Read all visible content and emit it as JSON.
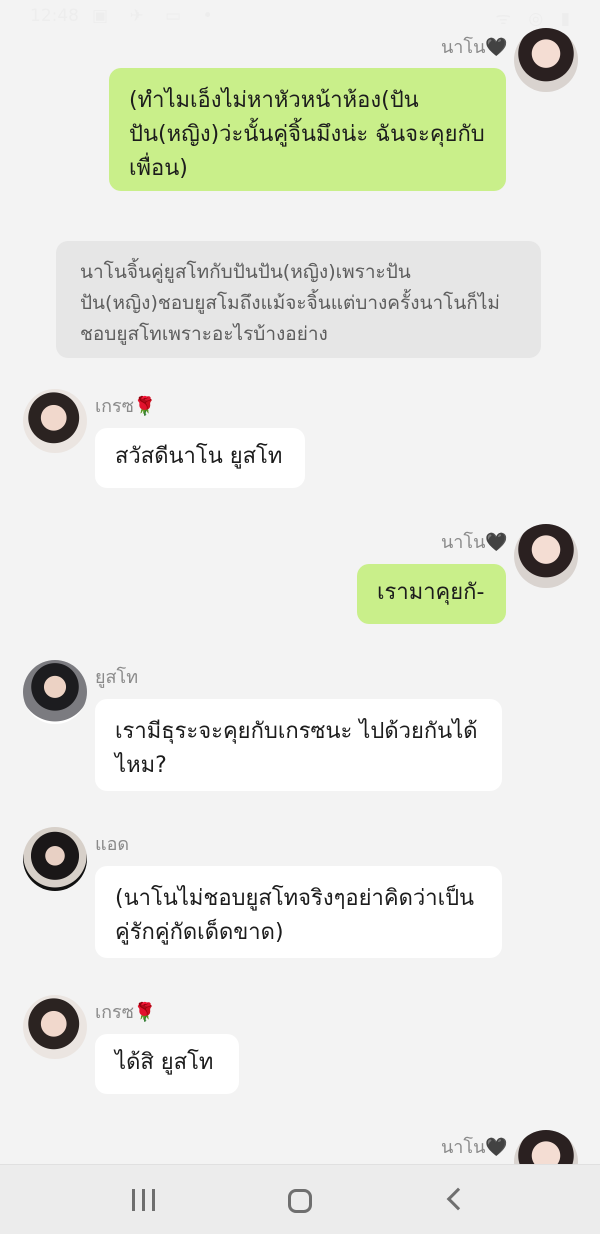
{
  "status_bar": {
    "time": "12:48",
    "left_icons": "▣ ✈ ▭ •",
    "right_icons": "ᯤ ◎ ▮"
  },
  "system_note": "นาโนจิ้นคู่ยูสโทกับปันปัน(หญิง)เพราะปันปัน(หญิง)ชอบยูสโมถึงแม้จะจิ้นแต่บางครั้งนาโนก็ไม่ชอบยูสโทเพราะอะไรบ้างอย่าง",
  "messages": [
    {
      "sender": "นาโน🖤",
      "text": "(ทำไมเอ็งไม่หาหัวหน้าห้อง(ปันปัน(หญิง)ว่ะนั้นคู่จิ้นมึงน่ะ ฉันจะคุยกับเพื่อน)",
      "direction": "outgoing"
    },
    {
      "sender": "เกรซ🌹",
      "text": "สวัสดีนาโน ยูสโท",
      "direction": "incoming"
    },
    {
      "sender": "นาโน🖤",
      "text": "เรามาคุยกั-",
      "direction": "outgoing"
    },
    {
      "sender": "ยูสโท",
      "text": "เรามีธุระจะคุยกับเกรซนะ ไปด้วยกันได้ไหม?",
      "direction": "incoming"
    },
    {
      "sender": "แอด",
      "text": "(นาโนไม่ชอบยูสโทจริงๆอย่าคิดว่าเป็นคู่รักคู่กัดเด็ดขาด)",
      "direction": "incoming"
    },
    {
      "sender": "เกรซ🌹",
      "text": "ได้สิ ยูสโท",
      "direction": "incoming"
    },
    {
      "sender": "นาโน🖤",
      "text": "",
      "direction": "outgoing"
    }
  ],
  "nav": {
    "recent": "recent-apps",
    "home": "home",
    "back": "back"
  },
  "colors": {
    "outgoing_bubble": "#c9ef8a",
    "incoming_bubble": "#ffffff",
    "background": "#f3f3f3"
  }
}
